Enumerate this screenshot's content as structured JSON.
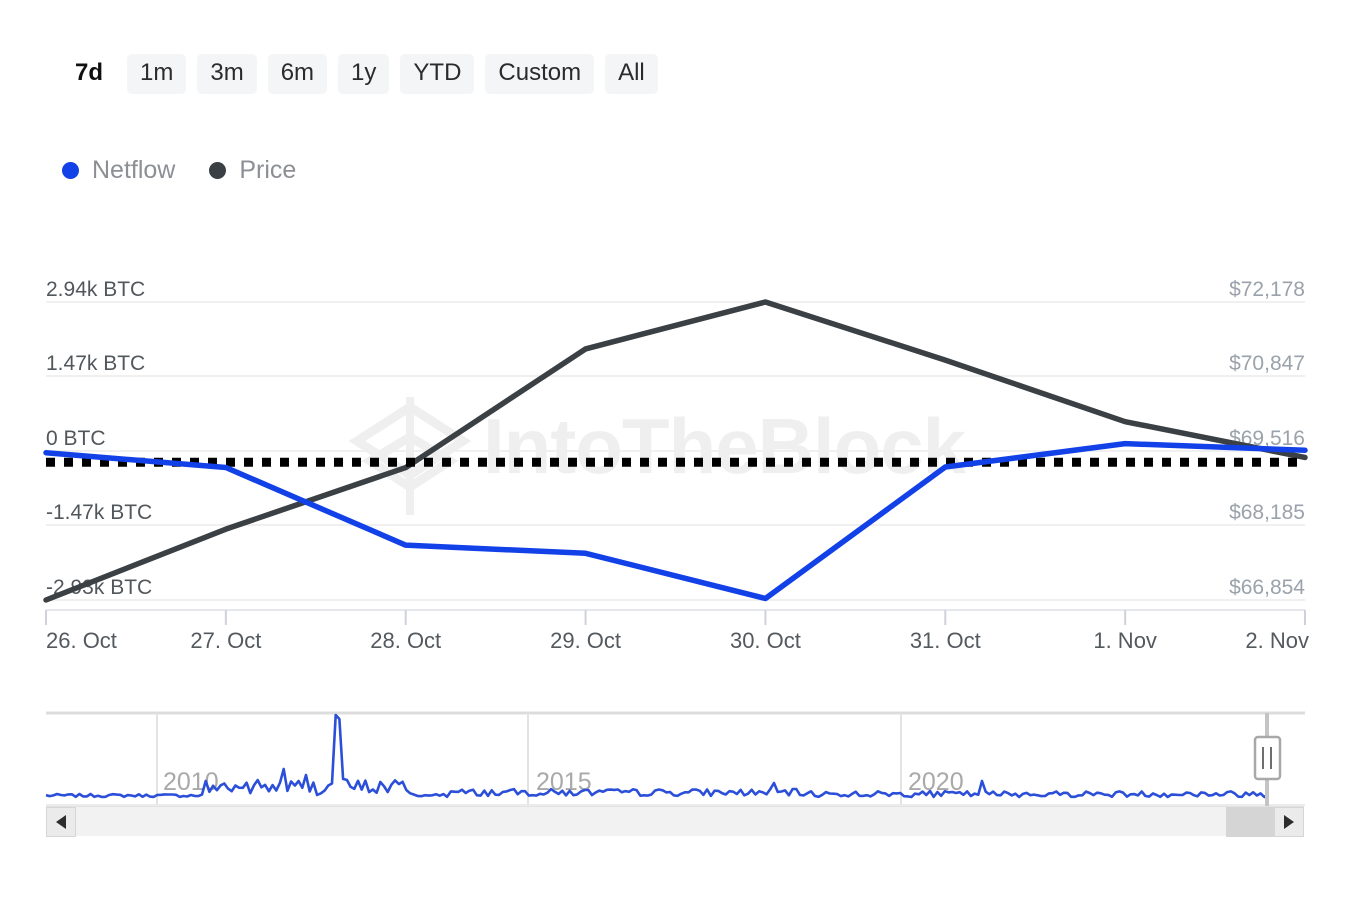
{
  "range_selector": {
    "buttons": [
      {
        "label": "7d",
        "active": true
      },
      {
        "label": "1m",
        "active": false
      },
      {
        "label": "3m",
        "active": false
      },
      {
        "label": "6m",
        "active": false
      },
      {
        "label": "1y",
        "active": false
      },
      {
        "label": "YTD",
        "active": false
      },
      {
        "label": "Custom",
        "active": false
      },
      {
        "label": "All",
        "active": false
      }
    ]
  },
  "legend": {
    "items": [
      {
        "label": "Netflow",
        "color": "#1241e8"
      },
      {
        "label": "Price",
        "color": "#3b4045"
      }
    ]
  },
  "watermark": {
    "text": "IntoTheBlock",
    "color": "#efefef"
  },
  "navigator": {
    "years": [
      "2010",
      "2015",
      "2020"
    ],
    "series_color": "#2b4fd8",
    "handle_label": "range-handle-right"
  },
  "chart_data": {
    "type": "line",
    "title": "",
    "xlabel": "",
    "grid": true,
    "legend_position": "top-left",
    "categories": [
      "26. Oct",
      "27. Oct",
      "28. Oct",
      "29. Oct",
      "30. Oct",
      "31. Oct",
      "1. Nov",
      "2. Nov"
    ],
    "axes": {
      "left": {
        "label": "Netflow",
        "unit": "BTC",
        "tick_labels": [
          "2.94k BTC",
          "1.47k BTC",
          "0 BTC",
          "-1.47k BTC",
          "-2.93k BTC"
        ],
        "tick_values": [
          2940,
          1470,
          0,
          -1470,
          -2930
        ],
        "ylim": [
          -2930,
          2940
        ]
      },
      "right": {
        "label": "Price",
        "unit": "USD",
        "tick_labels": [
          "$72,178",
          "$70,847",
          "$69,516",
          "$68,185",
          "$66,854"
        ],
        "tick_values": [
          72178,
          70847,
          69516,
          68185,
          66854
        ],
        "ylim": [
          66854,
          72178
        ]
      }
    },
    "zero_line": {
      "value": 0,
      "style": "dotted",
      "color": "#000000"
    },
    "series": [
      {
        "name": "Netflow",
        "axis": "left",
        "color": "#1241e8",
        "unit": "BTC",
        "values": [
          -30,
          -320,
          -1850,
          -2010,
          -2900,
          -310,
          150,
          20
        ]
      },
      {
        "name": "Price",
        "axis": "right",
        "color": "#3b4045",
        "unit": "USD",
        "values": [
          66854,
          68120,
          69220,
          71340,
          72178,
          71140,
          70040,
          69400
        ]
      }
    ]
  }
}
